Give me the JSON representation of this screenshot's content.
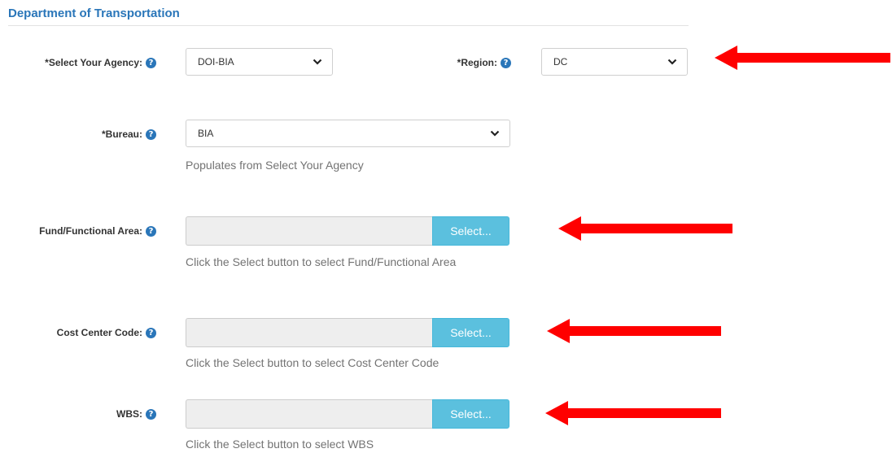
{
  "section": {
    "title": "Department of Transportation"
  },
  "agency": {
    "label": "*Select Your Agency:",
    "value": "DOI-BIA"
  },
  "region": {
    "label": "*Region:",
    "value": "DC"
  },
  "bureau": {
    "label": "*Bureau:",
    "value": "BIA",
    "help": "Populates from Select Your Agency"
  },
  "fund_area": {
    "label": "Fund/Functional Area:",
    "button": "Select...",
    "help": "Click the Select button to select Fund/Functional Area"
  },
  "cost_center": {
    "label": "Cost Center Code:",
    "button": "Select...",
    "help": "Click the Select button to select Cost Center Code"
  },
  "wbs": {
    "label": "WBS:",
    "button": "Select...",
    "help": "Click the Select button to select WBS"
  },
  "icons": {
    "info": "question-circle-icon",
    "dropdown": "chevron-down-icon",
    "annotation": "red-arrow-icon"
  },
  "colors": {
    "title": "#2a76b9",
    "select_button": "#5bc0de",
    "arrow": "#ff0000"
  }
}
